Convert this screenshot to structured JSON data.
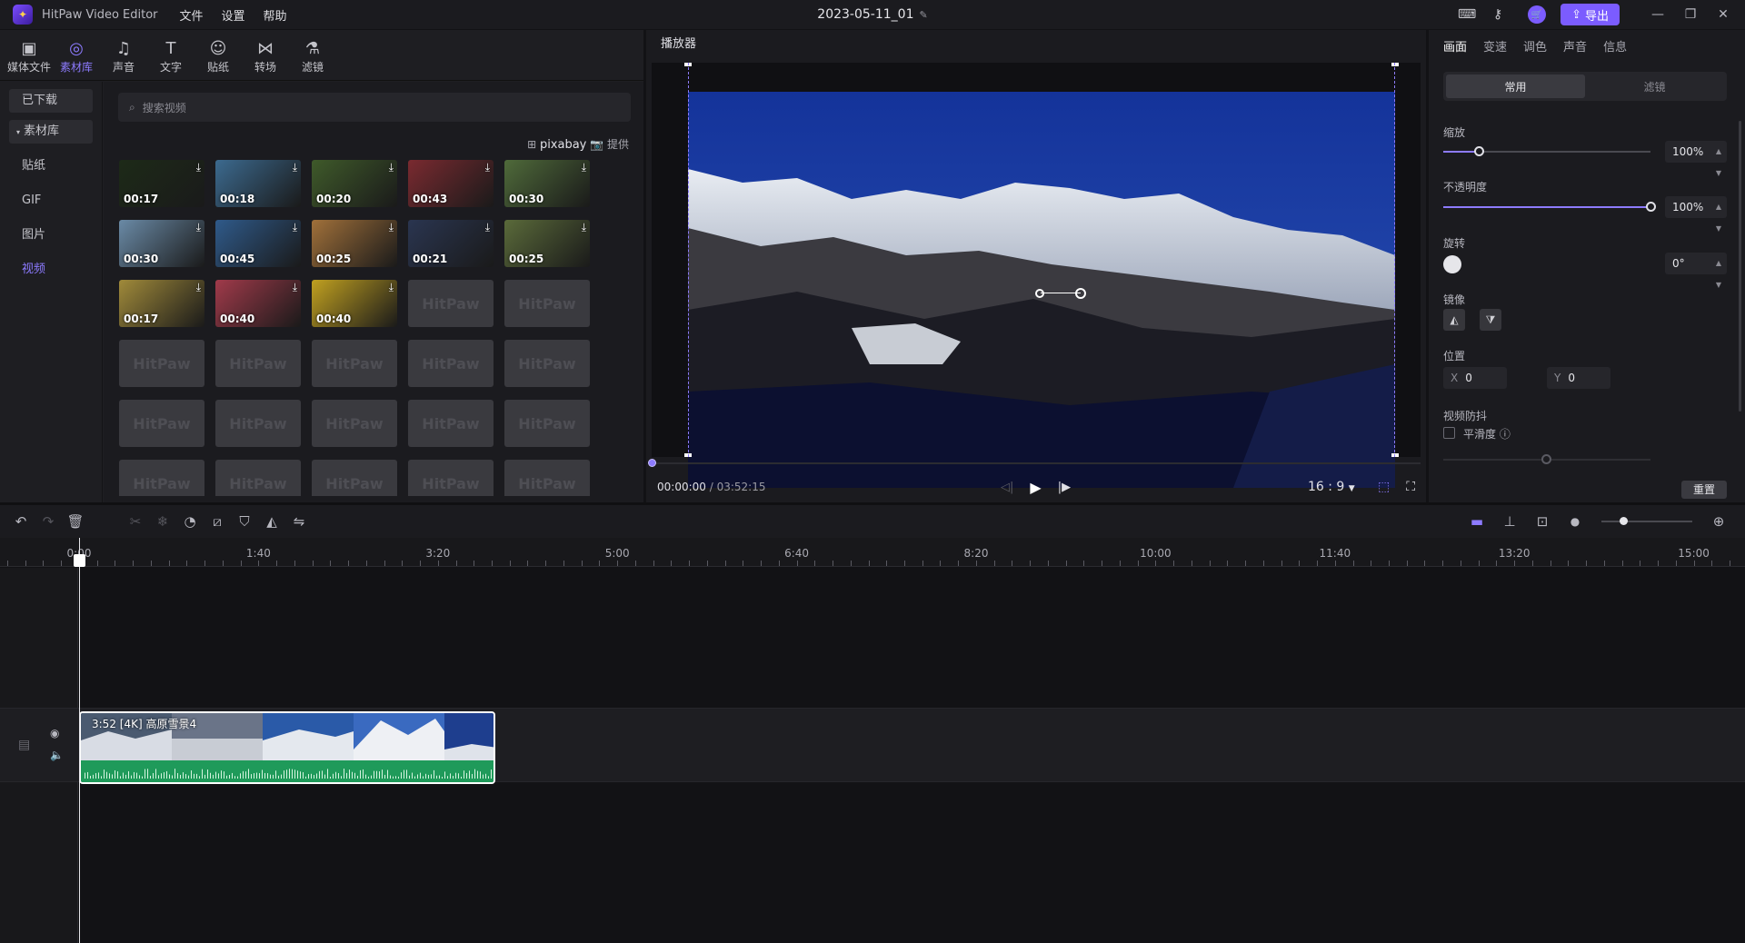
{
  "app": {
    "name": "HitPaw Video Editor",
    "menus": [
      "文件",
      "设置",
      "帮助"
    ],
    "project": "2023-05-11_01",
    "export_label": "导出"
  },
  "lib_tabs": [
    {
      "label": "媒体文件",
      "icon": "media-icon"
    },
    {
      "label": "素材库",
      "icon": "globe-icon"
    },
    {
      "label": "声音",
      "icon": "music-icon"
    },
    {
      "label": "文字",
      "icon": "text-icon"
    },
    {
      "label": "贴纸",
      "icon": "sticker-icon"
    },
    {
      "label": "转场",
      "icon": "transition-icon"
    },
    {
      "label": "滤镜",
      "icon": "filter-icon"
    }
  ],
  "lib_side": [
    "已下载",
    "素材库",
    "贴纸",
    "GIF",
    "图片",
    "视频"
  ],
  "search": {
    "placeholder": "搜索视频"
  },
  "credit": {
    "brand": "pixabay",
    "suffix": "提供"
  },
  "thumbs": [
    {
      "dur": "00:17",
      "color": "#1d2a18"
    },
    {
      "dur": "00:18",
      "color": "#3c6a8f"
    },
    {
      "dur": "00:20",
      "color": "#3f5a2a"
    },
    {
      "dur": "00:43",
      "color": "#7a2a30"
    },
    {
      "dur": "00:30",
      "color": "#4f6a3a"
    },
    {
      "dur": "00:30",
      "color": "#6a8aa6"
    },
    {
      "dur": "00:45",
      "color": "#2f5a8a"
    },
    {
      "dur": "00:25",
      "color": "#a0703a"
    },
    {
      "dur": "00:21",
      "color": "#2a3550"
    },
    {
      "dur": "00:25",
      "color": "#5a6a3a"
    },
    {
      "dur": "00:17",
      "color": "#a08a3a"
    },
    {
      "dur": "00:40",
      "color": "#a03a4a"
    },
    {
      "dur": "00:40",
      "color": "#c0a020"
    }
  ],
  "placeholder_text": "HitPaw",
  "player": {
    "title": "播放器",
    "time_current": "00:00:00",
    "time_total": "/ 03:52:15",
    "ratio": "16 : 9"
  },
  "props": {
    "tabs": [
      "画面",
      "变速",
      "调色",
      "声音",
      "信息"
    ],
    "seg": [
      "常用",
      "滤镜"
    ],
    "scale_label": "缩放",
    "scale_value": "100%",
    "scale_pos": 0.17,
    "opacity_label": "不透明度",
    "opacity_value": "100%",
    "opacity_pos": 1.0,
    "rotate_label": "旋转",
    "rotate_value": "0°",
    "mirror_label": "镜像",
    "position_label": "位置",
    "pos_x_axis": "X",
    "pos_x": "0",
    "pos_y_axis": "Y",
    "pos_y": "0",
    "stabilize_label": "视频防抖",
    "smooth_label": "平滑度",
    "reset_label": "重置"
  },
  "ruler_labels": [
    "0:00",
    "1:40",
    "3:20",
    "5:00",
    "6:40",
    "8:20",
    "10:00",
    "11:40",
    "13:20",
    "15:00"
  ],
  "clip": {
    "label": "3:52     [4K]   高原雪景4"
  }
}
